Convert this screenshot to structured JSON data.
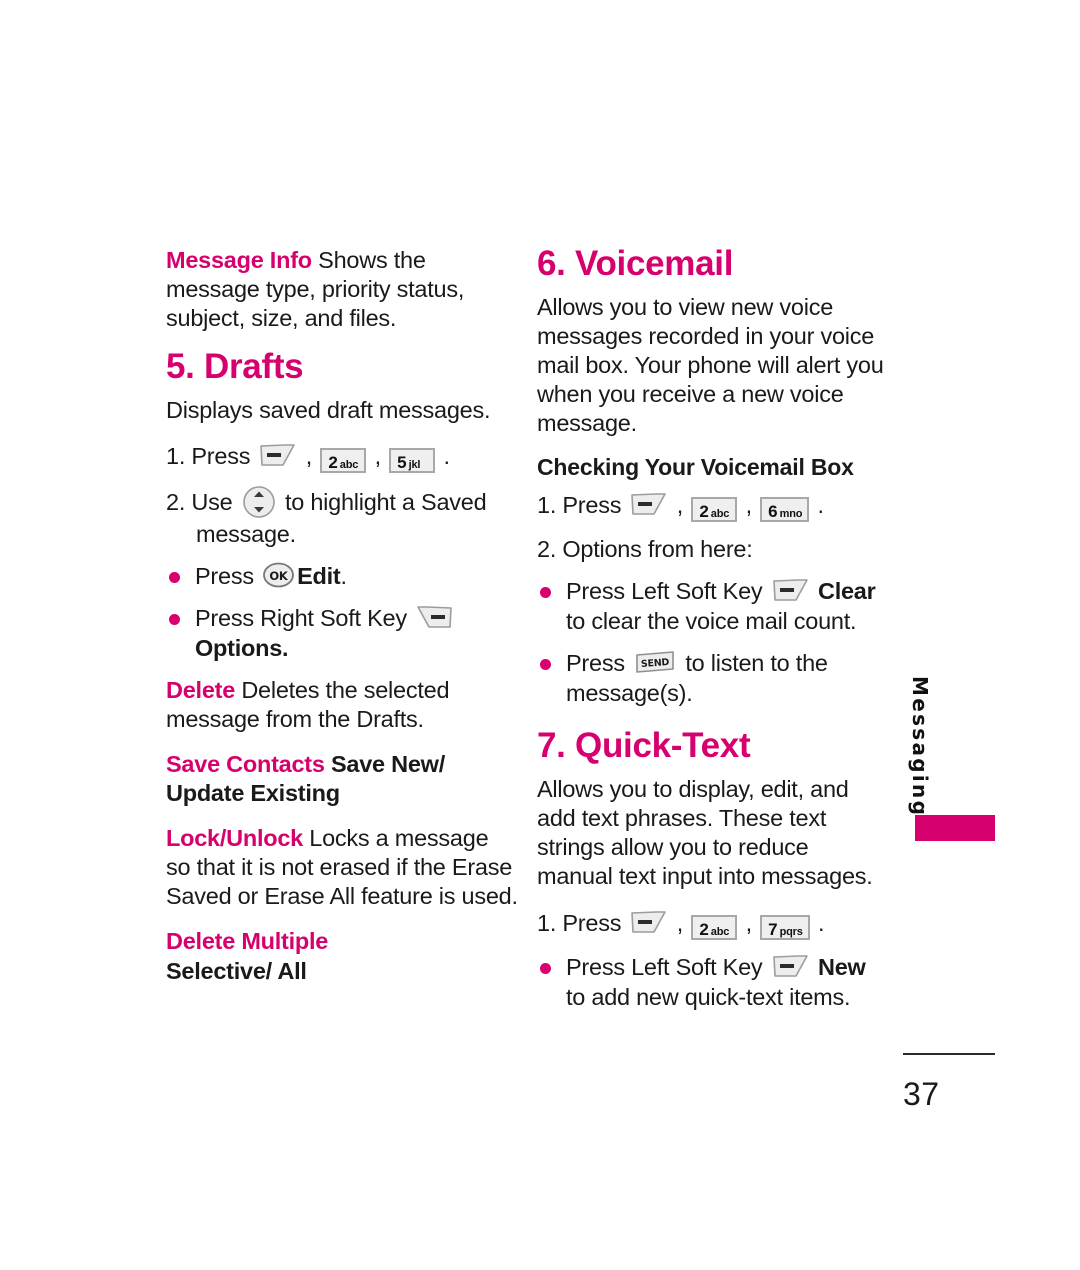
{
  "page": {
    "number": "37",
    "chapter_tab": "Messaging",
    "accent_color": "#d6006e",
    "text_color": "#1a1a1a"
  },
  "left_column": {
    "message_info": {
      "term": "Message Info",
      "description": " Shows the message type, priority status, subject, size, and files."
    },
    "drafts": {
      "heading": "5. Drafts",
      "intro": "Displays saved draft messages.",
      "step1_prefix": "1. Press",
      "step1_sep1": ",",
      "step1_sep2": ",",
      "step1_end": ".",
      "step1_keys": [
        {
          "icon": "left-soft-key-icon"
        },
        {
          "icon": "keypad-key-icon",
          "digit": "2",
          "letters": "abc"
        },
        {
          "icon": "keypad-key-icon",
          "digit": "5",
          "letters": "jkl"
        }
      ],
      "step2_prefix": "2. Use",
      "step2_suffix": "to highlight a Saved message.",
      "step2_icon": "navigation-wheel-icon",
      "bullets": [
        {
          "prefix": "Press",
          "icon": "ok-key-icon",
          "bold_label": "Edit",
          "suffix": "."
        },
        {
          "prefix": "Press Right Soft Key",
          "icon": "right-soft-key-icon",
          "bold_label": "Options",
          "suffix": "."
        }
      ],
      "delete": {
        "term": "Delete",
        "description": " Deletes the selected message from the Drafts."
      },
      "save_contacts": {
        "term": "Save Contacts",
        "description": " Save New/ Update Existing"
      },
      "lock_unlock": {
        "term": "Lock/Unlock",
        "description": " Locks a message so that it is not erased if the Erase Saved or Erase All feature is used."
      },
      "delete_multiple": {
        "term": "Delete Multiple",
        "description": "Selective/ All"
      }
    }
  },
  "right_column": {
    "voicemail": {
      "heading": "6. Voicemail",
      "intro": "Allows you to view new voice messages recorded in your voice mail box. Your phone will alert you when you receive a new voice message.",
      "subheading": "Checking Your Voicemail Box",
      "step1_prefix": "1. Press",
      "step1_sep1": ",",
      "step1_sep2": ",",
      "step1_end": ".",
      "step1_keys": [
        {
          "icon": "left-soft-key-icon"
        },
        {
          "icon": "keypad-key-icon",
          "digit": "2",
          "letters": "abc"
        },
        {
          "icon": "keypad-key-icon",
          "digit": "6",
          "letters": "mno"
        }
      ],
      "step2": "2. Options from here:",
      "bullets": [
        {
          "prefix": "Press Left Soft Key",
          "icon": "left-soft-key-icon",
          "bold_label": "Clear",
          "suffix": "to clear the voice mail count."
        },
        {
          "prefix": "Press",
          "icon": "send-key-icon",
          "bold_label": "",
          "suffix": "to listen to the message(s)."
        }
      ]
    },
    "quick_text": {
      "heading": "7. Quick-Text",
      "intro": "Allows you to display, edit, and add text phrases. These text strings allow you to reduce manual text input into messages.",
      "step1_prefix": "1. Press",
      "step1_sep1": ",",
      "step1_sep2": ",",
      "step1_end": ".",
      "step1_keys": [
        {
          "icon": "left-soft-key-icon"
        },
        {
          "icon": "keypad-key-icon",
          "digit": "2",
          "letters": "abc"
        },
        {
          "icon": "keypad-key-icon",
          "digit": "7",
          "letters": "pqrs"
        }
      ],
      "bullet": {
        "prefix": "Press Left Soft Key",
        "icon": "left-soft-key-icon",
        "bold_label": "New",
        "suffix": "to add new quick-text items."
      }
    }
  }
}
